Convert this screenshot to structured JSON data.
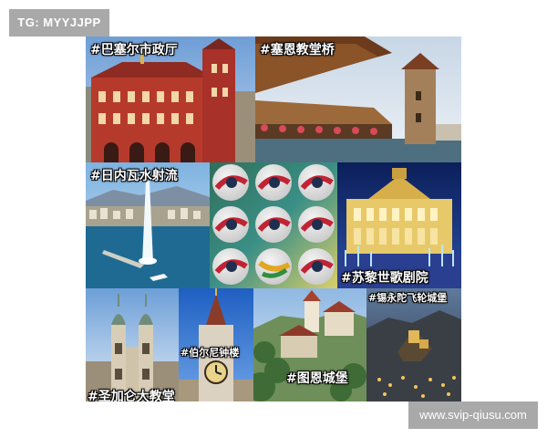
{
  "watermarks": {
    "top_left": "TG: MYYJJPP",
    "bottom_right": "www.svip-qiusu.com"
  },
  "collage": {
    "tiles": [
      {
        "id": "basel-town-hall",
        "caption": "#巴塞尔市政厅"
      },
      {
        "id": "chapel-bridge",
        "caption": "#塞恩教堂桥"
      },
      {
        "id": "geneva-jet",
        "caption": "#日内瓦水射流"
      },
      {
        "id": "football-balls",
        "caption": ""
      },
      {
        "id": "zurich-opera",
        "caption": "#苏黎世歌剧院"
      },
      {
        "id": "st-gallen-cathedral",
        "caption": "#圣加仑大教堂"
      },
      {
        "id": "bern-clock-tower",
        "caption": "#伯尔尼钟楼"
      },
      {
        "id": "thun-castle",
        "caption": "#图恩城堡"
      },
      {
        "id": "sion-castle",
        "caption": "#锡永陀飞轮城堡"
      }
    ]
  }
}
